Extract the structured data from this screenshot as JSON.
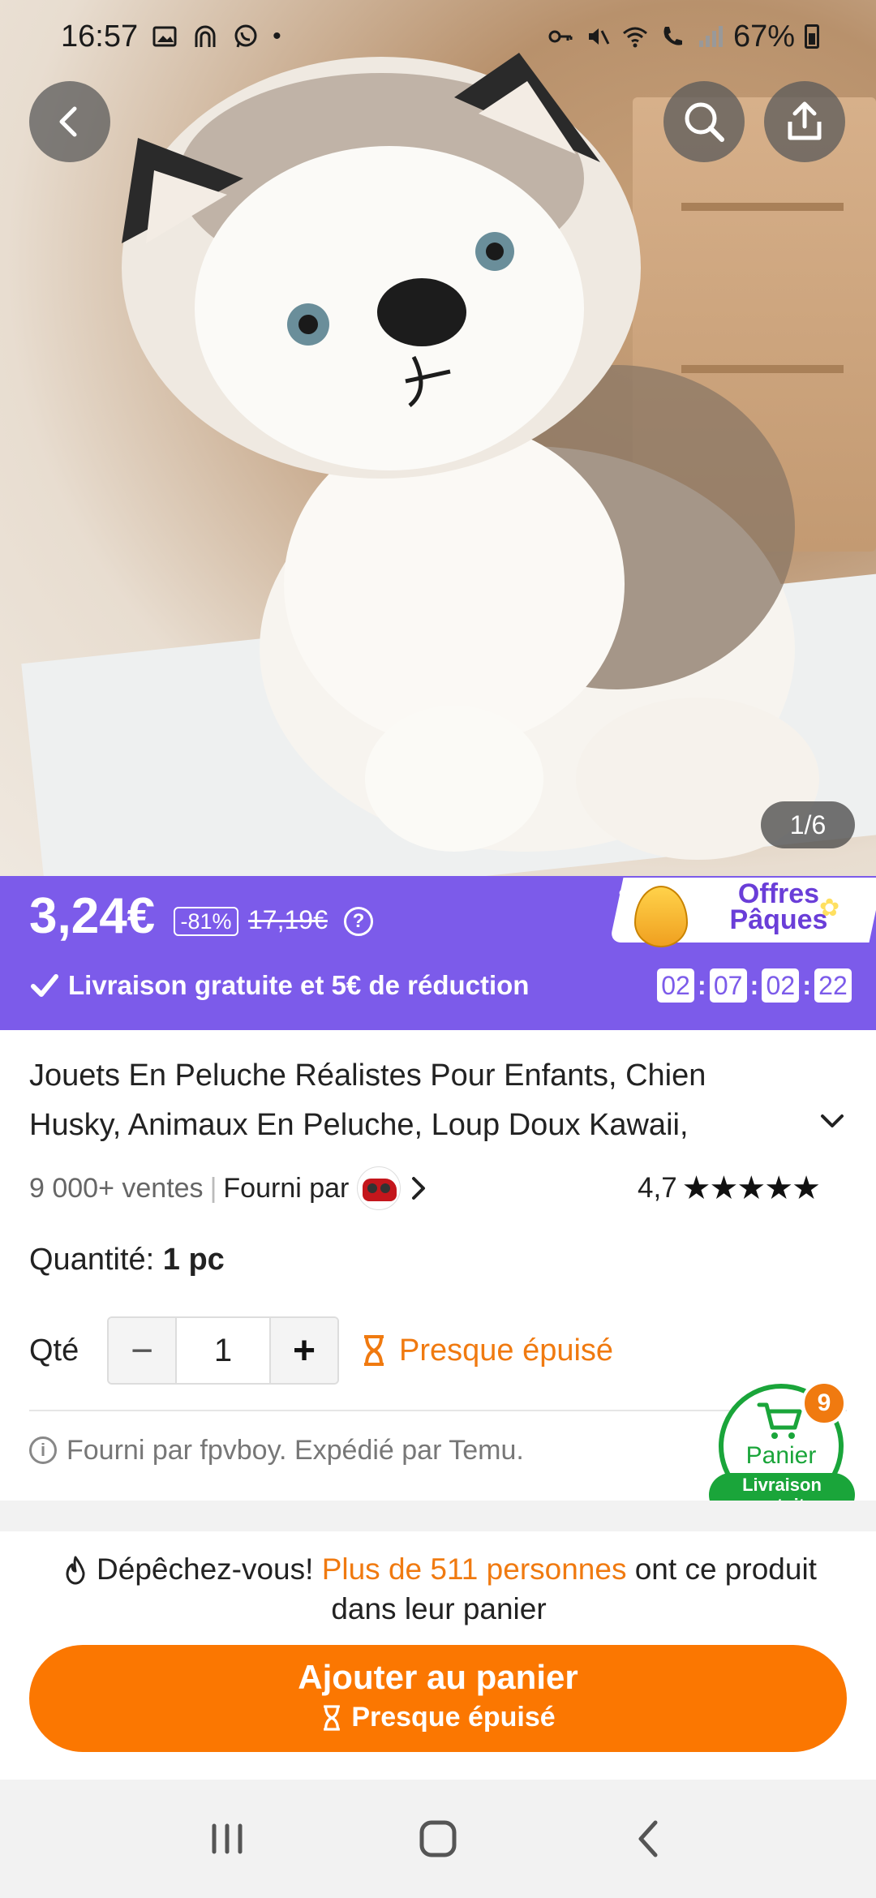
{
  "status_bar": {
    "time": "16:57",
    "battery": "67%",
    "icons_left": [
      "image-icon",
      "podcast-icon",
      "whatsapp-icon",
      "dot-icon"
    ],
    "icons_right": [
      "key-icon",
      "mute-icon",
      "wifi-icon",
      "call-icon",
      "signal-icon",
      "battery-icon"
    ]
  },
  "hero": {
    "page_indicator": "1/6",
    "back_icon": "back-arrow-icon",
    "search_icon": "search-icon",
    "share_icon": "share-icon"
  },
  "price": {
    "current": "3,24€",
    "discount": "-81%",
    "original": "17,19€",
    "shipping": "Livraison gratuite et 5€ de réduction",
    "promo_line1": "Offres",
    "promo_line2": "Pâques",
    "timer": [
      "02",
      "07",
      "02",
      "22"
    ]
  },
  "product": {
    "title": "Jouets En Peluche Réalistes Pour Enfants, Chien Husky, Animaux En Peluche, Loup Doux Kawaii,",
    "sales": "9 000+ ventes",
    "supplied_by": "Fourni par",
    "rating": "4,7",
    "stars": "★★★★★",
    "rating_value": 4.7
  },
  "quantity": {
    "label": "Quantité:",
    "value_label": "1 pc",
    "qte_label": "Qté",
    "value": "1",
    "minus": "−",
    "plus": "+",
    "stock_status": "Presque épuisé"
  },
  "supplier_note": "Fourni par fpvboy. Expédié par Temu.",
  "cart": {
    "label": "Panier",
    "badge": "9",
    "free_line1": "Livraison",
    "free_line2": "gratuite"
  },
  "urgency": {
    "prefix": "Dépêchez-vous!",
    "highlight": "Plus de 511 personnes",
    "suffix": "ont ce produit dans leur panier"
  },
  "cta": {
    "label": "Ajouter au panier",
    "sublabel": "Presque épuisé"
  },
  "colors": {
    "accent_purple": "#7c5bea",
    "accent_orange": "#fb7701",
    "cart_green": "#1aa53a"
  }
}
